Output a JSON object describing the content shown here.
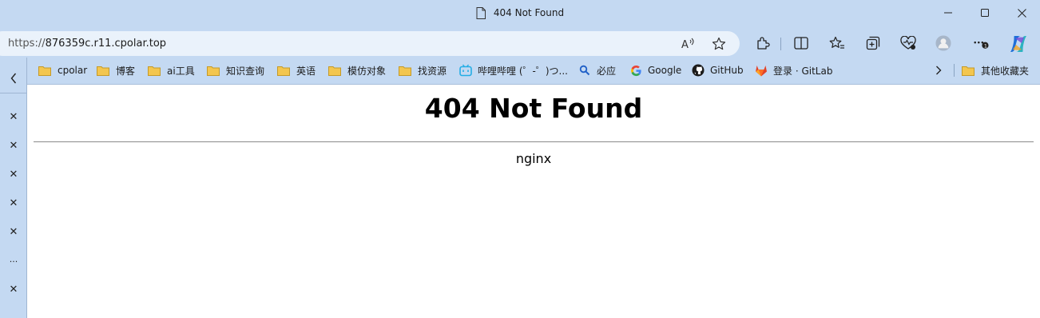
{
  "window": {
    "title": "404 Not Found",
    "controls": {
      "minimize": "—",
      "maximize": "☐",
      "close": "✕"
    }
  },
  "address_bar": {
    "scheme": "https://",
    "host": "876359c.r11.cpolar.top"
  },
  "bookmarks": [
    {
      "label": "cpolar",
      "type": "folder"
    },
    {
      "label": "博客",
      "type": "folder"
    },
    {
      "label": "ai工具",
      "type": "folder"
    },
    {
      "label": "知识查询",
      "type": "folder"
    },
    {
      "label": "英语",
      "type": "folder"
    },
    {
      "label": "模仿对象",
      "type": "folder"
    },
    {
      "label": "找资源",
      "type": "folder"
    },
    {
      "label": "哔哩哔哩 (゜-゜)つ...",
      "type": "bilibili-icon"
    },
    {
      "label": "必应",
      "type": "bing-search-icon"
    },
    {
      "label": "Google",
      "type": "google-icon"
    },
    {
      "label": "GitHub",
      "type": "github-icon"
    },
    {
      "label": "登录 · GitLab",
      "type": "gitlab-icon"
    }
  ],
  "other_bookmarks": "其他收藏夹",
  "sidebar": {
    "collapse": "‹",
    "items": [
      "✕",
      "✕",
      "✕",
      "✕",
      "✕",
      "...",
      "✕"
    ]
  },
  "page": {
    "heading": "404 Not Found",
    "server": "nginx"
  },
  "colors": {
    "chrome": "#c4d9f2",
    "address_bg": "#eaf2fb",
    "content_bg": "#ffffff",
    "folder": "#f3c64f",
    "gitlab": "#e24329",
    "bilibili": "#23ade5"
  }
}
